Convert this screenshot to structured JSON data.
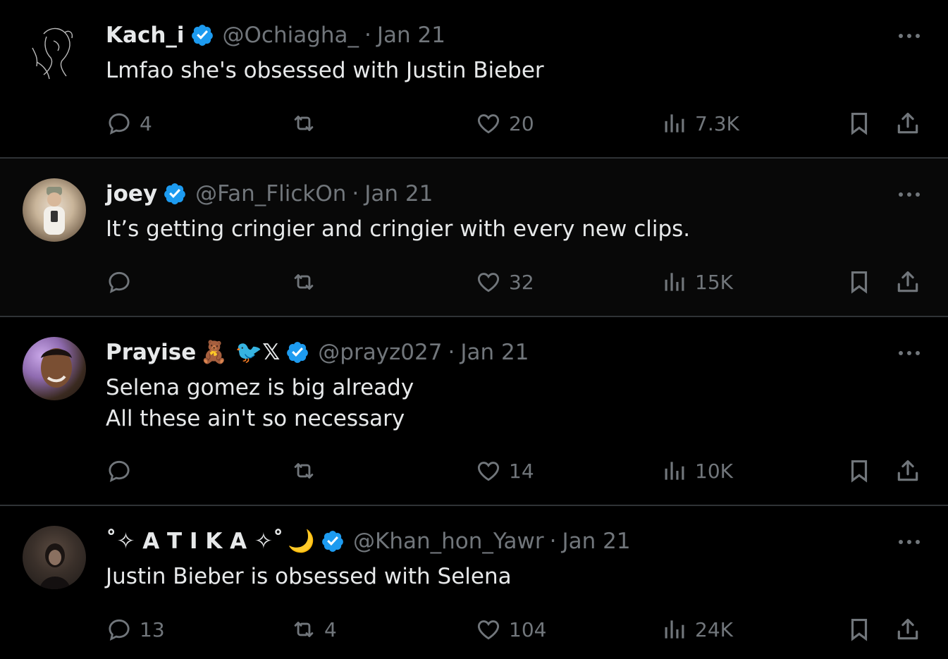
{
  "tweets": [
    {
      "name": "Kach_i",
      "emojis": "",
      "handle": "@Ochiagha_",
      "date": "Jan 21",
      "lines": [
        "Lmfao she's obsessed with Justin Bieber"
      ],
      "replies": "4",
      "reposts": "",
      "likes": "20",
      "views": "7.3K",
      "avatar": "line-art-face"
    },
    {
      "name": "joey",
      "emojis": "",
      "handle": "@Fan_FlickOn",
      "date": "Jan 21",
      "lines": [
        "It’s getting cringier and cringier with every new clips."
      ],
      "replies": "",
      "reposts": "",
      "likes": "32",
      "views": "15K",
      "avatar": "mirror-selfie-photo"
    },
    {
      "name": "Prayise",
      "emojis": "🧸 🐦𝕏",
      "handle": "@prayz027",
      "date": "Jan 21",
      "lines": [
        "Selena gomez is big already",
        "All these ain't so necessary"
      ],
      "replies": "",
      "reposts": "",
      "likes": "14",
      "views": "10K",
      "avatar": "smiling-man-photo"
    },
    {
      "name": "˚✧ A T I K A ✧˚",
      "emojis": "🌙",
      "handle": "@Khan_hon_Yawr",
      "date": "Jan 21",
      "lines": [
        "Justin Bieber is obsessed with Selena"
      ],
      "replies": "13",
      "reposts": "4",
      "likes": "104",
      "views": "24K",
      "avatar": "dark-portrait-photo"
    }
  ],
  "colors": {
    "background": "#000000",
    "text": "#e7e9ea",
    "muted": "#71767b",
    "verified": "#1d9bf0",
    "divider": "#2f3336"
  },
  "icons": [
    "more-icon",
    "reply-icon",
    "repost-icon",
    "like-icon",
    "views-icon",
    "bookmark-icon",
    "share-icon",
    "verified-badge-icon"
  ]
}
